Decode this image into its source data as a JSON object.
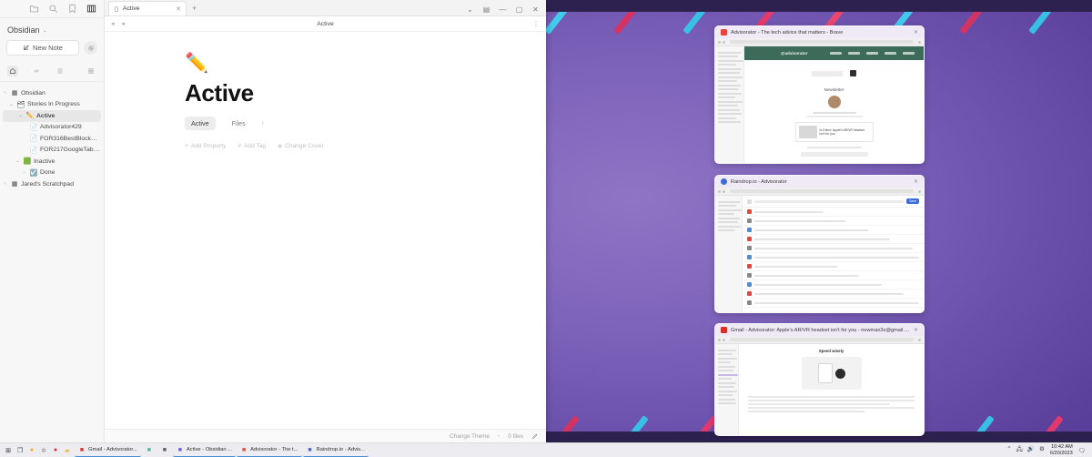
{
  "desktop": {
    "wallpaper_base": "#7e63bb",
    "wallpaper_edge": "#2d2150",
    "stripe_colors": [
      "#35c6e8",
      "#e8386a",
      "#f0466b",
      "#3ed2f0",
      "#d9325f"
    ]
  },
  "obsidian": {
    "sidebar": {
      "top_icons": [
        "folder-icon",
        "search-icon",
        "bookmark-icon",
        "grid-icon"
      ],
      "vault_name": "Obsidian",
      "vault_caret": "⌄",
      "new_note_label": "New Note",
      "new_note_icon": "pencil-square-icon",
      "settings_icon": "gear-icon",
      "tabs": [
        "home-icon",
        "link-icon",
        "list-icon",
        "layout-icon"
      ],
      "tree": [
        {
          "label": "Obsidian",
          "icon": "vault-icon",
          "indent": 0,
          "arrow": "›",
          "selected": false,
          "bold": false
        },
        {
          "label": "Stories In Progress",
          "icon": "folder-open-icon",
          "indent": 1,
          "arrow": "⌄",
          "selected": false,
          "bold": false
        },
        {
          "label": "Active",
          "icon": "pencil-emoji",
          "indent": 2,
          "arrow": "⌄",
          "selected": true,
          "bold": true
        },
        {
          "label": "Advisorator429",
          "icon": "file-icon",
          "indent": 3,
          "arrow": "",
          "selected": false,
          "bold": false
        },
        {
          "label": "FOR316BestBlock_Re...",
          "icon": "file-icon",
          "indent": 3,
          "arrow": "",
          "selected": false,
          "bold": false
        },
        {
          "label": "FOR217GoogleTablet...",
          "icon": "file-icon",
          "indent": 3,
          "arrow": "",
          "selected": false,
          "bold": false
        },
        {
          "label": "Inactive",
          "icon": "green-square-icon",
          "indent": 2,
          "arrow": "⌄",
          "selected": false,
          "bold": false
        },
        {
          "label": "Done",
          "icon": "checkbox-emoji",
          "indent": 3,
          "arrow": "›",
          "selected": false,
          "bold": false
        },
        {
          "label": "Jared's Scratchpad",
          "icon": "vault-icon",
          "indent": 0,
          "arrow": "›",
          "selected": false,
          "bold": false
        }
      ]
    },
    "tabbar": {
      "tab_icon": "document-icon",
      "tab_label": "Active",
      "close_label": "✕",
      "new_tab_label": "+"
    },
    "window_controls": [
      {
        "name": "dropdown-icon",
        "glyph": "⌄"
      },
      {
        "name": "sidebar-toggle-icon",
        "glyph": "▤"
      },
      {
        "name": "minimize-icon",
        "glyph": "—"
      },
      {
        "name": "maximize-icon",
        "glyph": "▢"
      },
      {
        "name": "close-icon",
        "glyph": "✕"
      }
    ],
    "editor_header": {
      "left_icons": [
        "back-arrow-icon",
        "forward-arrow-icon"
      ],
      "title": "Active",
      "more_icon": "⋮"
    },
    "document": {
      "emoji": "✏️",
      "title": "Active",
      "chips": [
        {
          "label": "Active",
          "style": "filled"
        },
        {
          "label": "Files",
          "style": "plain"
        }
      ],
      "chips_caret": "›",
      "actions": [
        {
          "icon": "+",
          "label": "Add Property"
        },
        {
          "icon": "#",
          "label": "Add Tag"
        },
        {
          "icon": "◈",
          "label": "Change Cover"
        }
      ]
    },
    "statusbar": {
      "theme_label": "Change Theme",
      "separator": "•",
      "files_label": "0 files",
      "edit_icon": "pencil-icon"
    }
  },
  "thumbnails": [
    {
      "name": "brave-advisorator-window",
      "title": "Advisorator - The tech advice that matters - Brave",
      "favicon": "brave-lion-icon",
      "favicon_color": "#e8443a",
      "brand_text": "@advisorator",
      "site_heading": "Newsletter",
      "card_caption": "Is it time: Apple's AR/VR headset isn't for you"
    },
    {
      "name": "raindrop-advisorator-window",
      "title": "Raindrop.io - Advisorator",
      "favicon": "raindrop-icon",
      "favicon_color": "#3d6bd8",
      "badge_label": "Save"
    },
    {
      "name": "gmail-advisorator-window",
      "title": "Gmail - Advisorator: Apple's AR/VR headset isn't for you - newman3x@gmail.com - Gmail",
      "favicon": "gmail-icon",
      "favicon_color": "#d93025",
      "email_heading": "Speed wisely"
    }
  ],
  "taskbar": {
    "system_icons": [
      {
        "name": "start-icon",
        "glyph": "⊞",
        "color": "#2f2f2f"
      },
      {
        "name": "task-view-icon",
        "glyph": "❐",
        "color": "#4a4a4a"
      },
      {
        "name": "firefox-icon",
        "glyph": "●",
        "color": "#f5a623"
      },
      {
        "name": "bluetooth-icon",
        "glyph": "✲",
        "color": "#8a8a8a"
      },
      {
        "name": "opera-icon",
        "glyph": "●",
        "color": "#e8263a"
      },
      {
        "name": "explorer-icon",
        "glyph": "▰",
        "color": "#f0b840"
      }
    ],
    "items": [
      {
        "name": "taskbar-gmail",
        "label": "Gmail - Advisorator...",
        "icon": "gmail-icon",
        "color": "#d93025",
        "active": true
      },
      {
        "name": "taskbar-unknown-app",
        "label": "",
        "icon": "app-icon",
        "color": "#4fb3a0",
        "active": false
      },
      {
        "name": "taskbar-notes-app",
        "label": "",
        "icon": "note-icon",
        "color": "#5a5a5a",
        "active": false
      },
      {
        "name": "taskbar-obsidian",
        "label": "Active - Obsidian ...",
        "icon": "obsidian-icon",
        "color": "#6c5bd4",
        "active": true
      },
      {
        "name": "taskbar-brave",
        "label": "Advisorator - The t...",
        "icon": "brave-lion-icon",
        "color": "#e8443a",
        "active": true
      },
      {
        "name": "taskbar-raindrop",
        "label": "Raindrop.io - Advis...",
        "icon": "raindrop-icon",
        "color": "#3d6bd8",
        "active": true
      }
    ],
    "tray": [
      {
        "name": "show-hidden-icons",
        "glyph": "⌃"
      },
      {
        "name": "network-icon",
        "glyph": "🖧"
      },
      {
        "name": "volume-icon",
        "glyph": "🔊"
      },
      {
        "name": "settings-icon",
        "glyph": "⚙"
      }
    ],
    "clock_time": "10:42 AM",
    "clock_date": "6/20/2023",
    "notification_icon": "notification-icon"
  }
}
